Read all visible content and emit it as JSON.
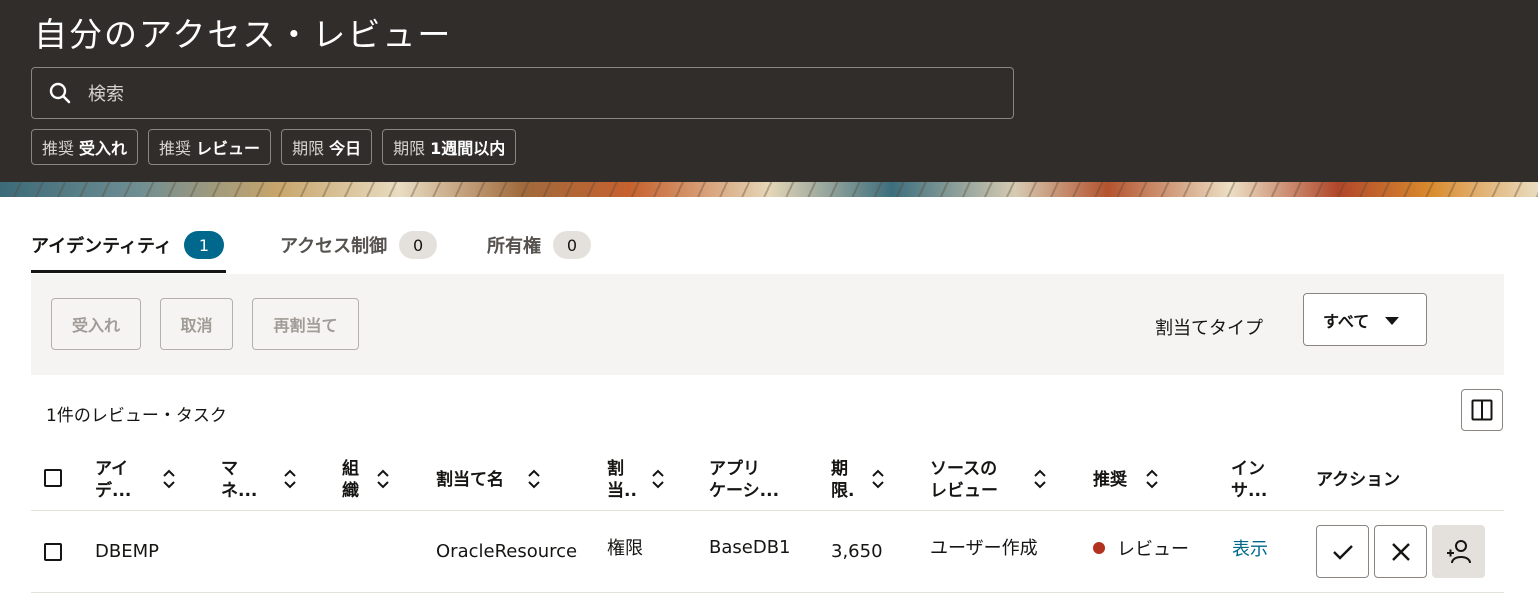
{
  "header": {
    "title": "自分のアクセス・レビュー",
    "search_placeholder": "検索",
    "chips": [
      {
        "prefix": "推奨",
        "value": "受入れ"
      },
      {
        "prefix": "推奨",
        "value": "レビュー"
      },
      {
        "prefix": "期限",
        "value": "今日"
      },
      {
        "prefix": "期限",
        "value": "1週間以内"
      }
    ]
  },
  "tabs": [
    {
      "label": "アイデンティティ",
      "count": "1"
    },
    {
      "label": "アクセス制御",
      "count": "0"
    },
    {
      "label": "所有権",
      "count": "0"
    }
  ],
  "toolbar": {
    "accept_label": "受入れ",
    "cancel_label": "取消",
    "reassign_label": "再割当て",
    "assignment_type_label": "割当てタイプ",
    "assignment_type_value": "すべて"
  },
  "table": {
    "count_text": "1件のレビュー・タスク",
    "columns": [
      {
        "line1": "アイ",
        "line2": "デ..."
      },
      {
        "line1": "マ",
        "line2": "ネ..."
      },
      {
        "line1": "組",
        "line2": "織"
      },
      {
        "line1": "割当て名",
        "line2": ""
      },
      {
        "line1": "割",
        "line2": "当.."
      },
      {
        "line1": "アプリ",
        "line2": "ケーシ..."
      },
      {
        "line1": "期",
        "line2": "限."
      },
      {
        "line1": "ソースの",
        "line2": "レビュー"
      },
      {
        "line1": "推奨",
        "line2": ""
      },
      {
        "line1": "イン",
        "line2": "サ..."
      },
      {
        "line1": "アクション",
        "line2": ""
      }
    ],
    "rows": [
      {
        "identity": "DBEMP",
        "manager": "",
        "organization": "",
        "assignment_name": "OracleResource",
        "assignment_type": "権限",
        "application": "BaseDB1",
        "due": "3,650",
        "source_review": "ユーザー作成",
        "recommendation": "レビュー",
        "insight": "表示"
      }
    ]
  },
  "colors": {
    "header_bg": "#312d2a",
    "accent": "#00688c",
    "recommend_dot": "#b3311f"
  },
  "icons": [
    "search-icon",
    "chevron-down-icon",
    "columns-icon",
    "sort-icon",
    "check-icon",
    "close-icon",
    "reassign-user-icon"
  ]
}
